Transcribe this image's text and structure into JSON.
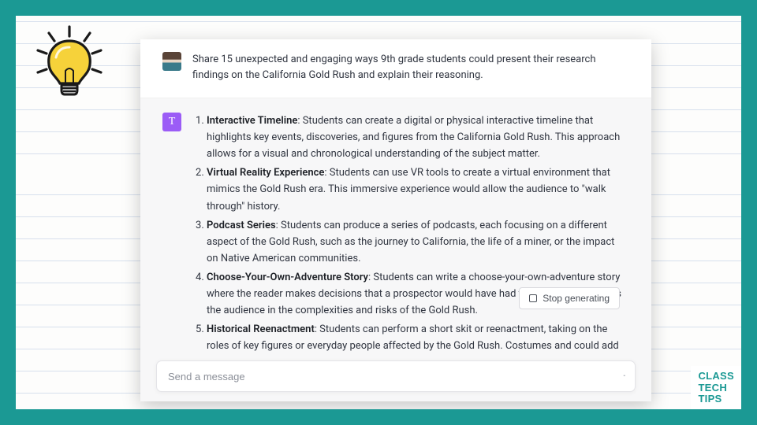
{
  "user_prompt": "Share 15 unexpected and engaging ways  9th grade students could present their research findings on the California Gold Rush and explain their reasoning.",
  "assistant_badge": "T",
  "ideas": [
    {
      "title": "Interactive Timeline",
      "desc": ": Students can create a digital or physical interactive timeline that highlights key events, discoveries, and figures from the California Gold Rush. This approach allows for a visual and chronological understanding of the subject matter."
    },
    {
      "title": "Virtual Reality Experience",
      "desc": ": Students can use VR tools to create a virtual environment that mimics the Gold Rush era. This immersive experience would allow the audience to \"walk through\" history."
    },
    {
      "title": "Podcast Series",
      "desc": ": Students can produce a series of podcasts, each focusing on a different aspect of the Gold Rush, such as the journey to California, the life of a miner, or the impact on Native American communities."
    },
    {
      "title": "Choose-Your-Own-Adventure Story",
      "desc": ": Students can write a choose-your-own-adventure story where the reader makes decisions that a prospector would have had to make. This engages the audience in the complexities and risks of the Gold Rush."
    },
    {
      "title": "Historical Reenactment",
      "desc": ": Students can perform a short skit or reenactment, taking on the roles of key figures or everyday people affected by the Gold Rush. Costumes and could add authenticity."
    }
  ],
  "stop_label": "Stop generating",
  "input_placeholder": "Send a message",
  "logo": {
    "l1": "CLASS",
    "l2": "TECH",
    "l3": "TIPS"
  }
}
